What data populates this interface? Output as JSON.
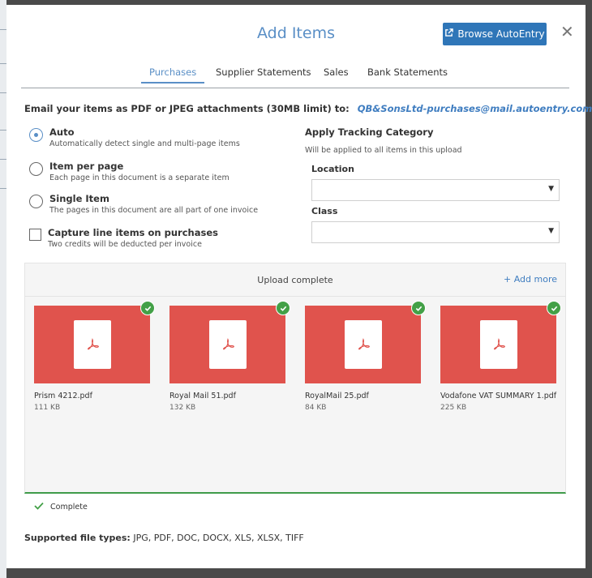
{
  "dialog": {
    "title": "Add Items",
    "browse_label": "Browse AutoEntry",
    "close_glyph": "✕"
  },
  "tabs": [
    {
      "label": "Purchases",
      "active": true
    },
    {
      "label": "Supplier Statements",
      "active": false
    },
    {
      "label": "Sales",
      "active": false
    },
    {
      "label": "Bank Statements",
      "active": false
    }
  ],
  "email": {
    "prefix": "Email your items as PDF or JPEG attachments (30MB limit) to:",
    "address": "QB&SonsLtd-purchases@mail.autoentry.com"
  },
  "options": [
    {
      "title": "Auto",
      "desc": "Automatically detect single and multi-page items",
      "selected": true
    },
    {
      "title": "Item per page",
      "desc": "Each page in this document is a separate item",
      "selected": false
    },
    {
      "title": "Single Item",
      "desc": "The pages in this document are all part of one invoice",
      "selected": false
    }
  ],
  "capture": {
    "title": "Capture line items on purchases",
    "desc": "Two credits will be deducted per invoice",
    "checked": false
  },
  "tracking": {
    "heading": "Apply Tracking Category",
    "desc": "Will be applied to all items in this upload",
    "location_label": "Location",
    "location_value": "",
    "class_label": "Class",
    "class_value": ""
  },
  "upload": {
    "status": "Upload complete",
    "add_more": "+ Add more",
    "files": [
      {
        "name": "Prism 4212.pdf",
        "size": "111 KB"
      },
      {
        "name": "Royal Mail 51.pdf",
        "size": "132 KB"
      },
      {
        "name": "RoyalMail 25.pdf",
        "size": "84 KB"
      },
      {
        "name": "Vodafone VAT SUMMARY 1.pdf",
        "size": "225 KB"
      }
    ],
    "complete_label": "Complete"
  },
  "supported": {
    "label": "Supported file types:",
    "types": "JPG, PDF, DOC, DOCX, XLS, XLSX, TIFF"
  },
  "colors": {
    "accent": "#5a8fc6",
    "button": "#2f76b8",
    "thumb": "#e0534d",
    "success": "#43a047"
  },
  "icons": {
    "browse": "external-link-icon",
    "close": "close-icon",
    "file": "pdf-icon",
    "badge": "check-circle-icon",
    "complete": "checkmark-icon"
  }
}
